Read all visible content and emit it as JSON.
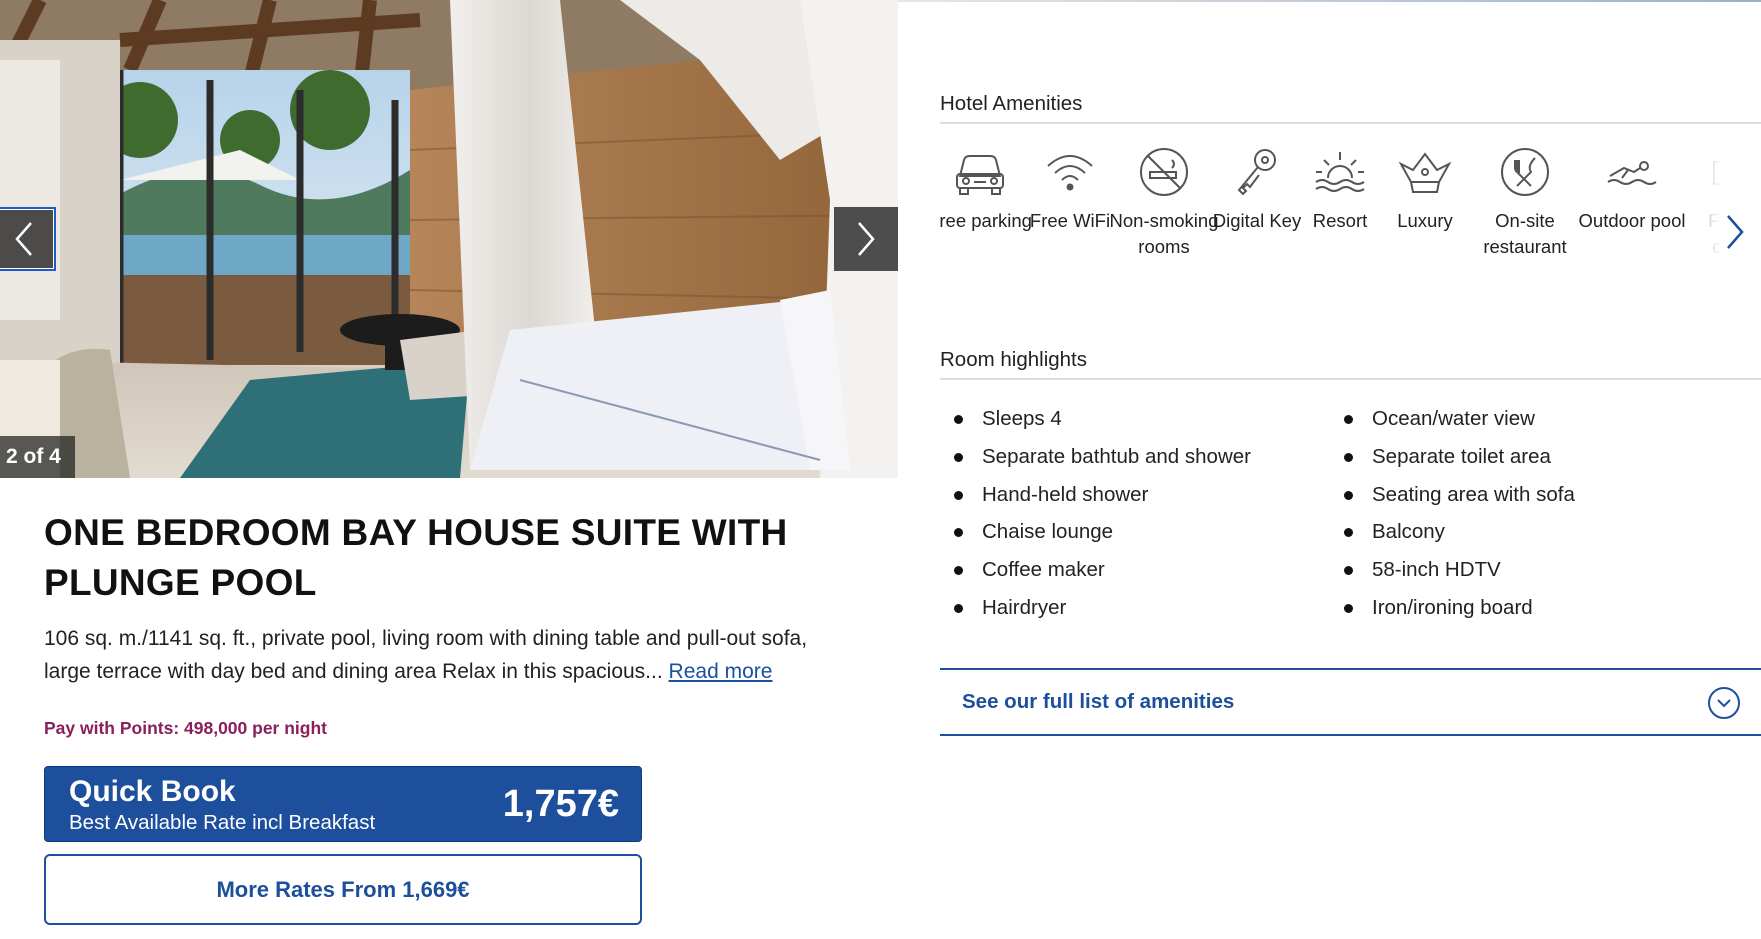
{
  "gallery": {
    "counter": "2 of 4",
    "prev_label": "Previous photo",
    "next_label": "Next photo"
  },
  "room": {
    "title": "ONE BEDROOM BAY HOUSE SUITE WITH PLUNGE POOL",
    "description": "106 sq. m./1141 sq. ft., private pool, living room with dining table and pull-out sofa, large terrace with day bed and dining area Relax in this spacious...",
    "read_more": "Read more",
    "points": "Pay with Points: 498,000 per night"
  },
  "quick_book": {
    "title": "Quick Book",
    "subtitle": "Best Available Rate incl Breakfast",
    "price": "1,757€"
  },
  "more_rates": {
    "label": "More Rates From 1,669€"
  },
  "amenities": {
    "heading": "Hotel Amenities",
    "items": [
      {
        "label": "Free parking",
        "icon": "car-icon"
      },
      {
        "label": "Free WiFi",
        "icon": "wifi-icon"
      },
      {
        "label": "Non-smoking rooms",
        "icon": "no-smoking-icon"
      },
      {
        "label": "Digital Key",
        "icon": "key-icon"
      },
      {
        "label": "Resort",
        "icon": "sunrise-icon"
      },
      {
        "label": "Luxury",
        "icon": "crown-icon"
      },
      {
        "label": "On-site restaurant",
        "icon": "restaurant-icon"
      },
      {
        "label": "Outdoor pool",
        "icon": "swimmer-icon"
      },
      {
        "label": "Fitness center",
        "icon": "dumbbell-icon"
      }
    ]
  },
  "highlights": {
    "heading": "Room highlights",
    "col1": [
      "Sleeps 4",
      "Separate bathtub and shower",
      "Hand-held shower",
      "Chaise lounge",
      "Coffee maker",
      "Hairdryer"
    ],
    "col2": [
      "Ocean/water view",
      "Separate toilet area",
      "Seating area with sofa",
      "Balcony",
      "58-inch HDTV",
      "Iron/ironing board"
    ]
  },
  "see_all": {
    "label": "See our full list of amenities"
  },
  "colors": {
    "brand_blue": "#1d4f9d",
    "points_magenta": "#8a1f5c"
  }
}
